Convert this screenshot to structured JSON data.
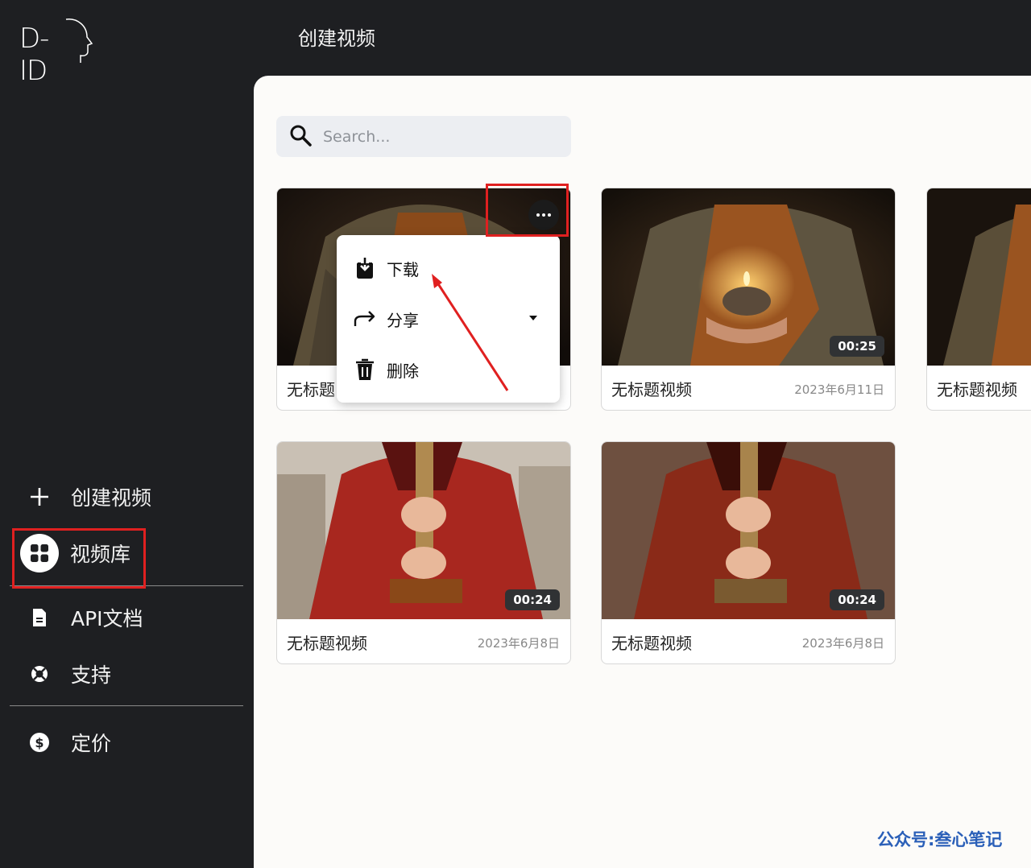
{
  "app": {
    "logo_text": "D-ID",
    "page_title": "创建视频"
  },
  "sidebar": {
    "items": [
      {
        "label": "创建视频",
        "icon": "plus-icon"
      },
      {
        "label": "视频库",
        "icon": "grid-icon",
        "active": true
      },
      {
        "label": "API文档",
        "icon": "document-icon"
      },
      {
        "label": "支持",
        "icon": "lifebuoy-icon"
      },
      {
        "label": "定价",
        "icon": "dollar-icon"
      }
    ]
  },
  "search": {
    "placeholder": "Search..."
  },
  "videos": [
    {
      "title": "无标题视频",
      "title_visible": "无标题",
      "date": "",
      "duration": "",
      "thumb": "monk-brown"
    },
    {
      "title": "无标题视频",
      "date": "2023年6月11日",
      "duration": "00:25",
      "thumb": "monk-brown-lamp"
    },
    {
      "title": "无标题视频",
      "date": "",
      "duration": "",
      "thumb": "monk-brown"
    },
    {
      "title": "无标题视频",
      "date": "2023年6月8日",
      "duration": "00:24",
      "thumb": "monk-red"
    },
    {
      "title": "无标题视频",
      "date": "2023年6月8日",
      "duration": "00:24",
      "thumb": "monk-red-dark"
    }
  ],
  "context_menu": {
    "items": [
      {
        "label": "下载",
        "icon": "download-icon"
      },
      {
        "label": "分享",
        "icon": "share-icon",
        "has_submenu": true
      },
      {
        "label": "删除",
        "icon": "trash-icon"
      }
    ]
  },
  "watermark": "公众号:叁心笔记",
  "colors": {
    "sidebar_bg": "#1e1f22",
    "main_bg": "#fcfbf9",
    "highlight_red": "#e02020",
    "watermark_blue": "#2a5fb8"
  }
}
